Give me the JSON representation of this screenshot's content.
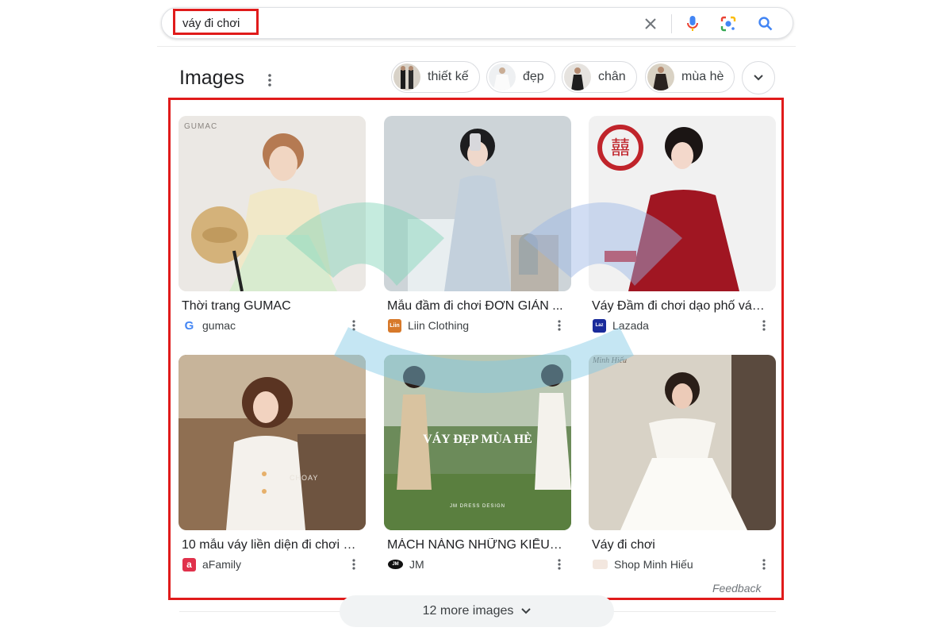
{
  "search": {
    "query": "váy đi chơi",
    "icons": [
      "close-icon",
      "microphone-icon",
      "lens-icon",
      "search-icon"
    ]
  },
  "images_section": {
    "title": "Images",
    "chips": [
      {
        "label": "thiết kế"
      },
      {
        "label": "đẹp"
      },
      {
        "label": "chân"
      },
      {
        "label": "mùa hè"
      }
    ],
    "results": [
      {
        "title": "Thời trang GUMAC",
        "source": "gumac",
        "image_text": "GUMAC"
      },
      {
        "title": "Mẫu đầm đi chơi ĐƠN GIẢN ...",
        "source": "Liin Clothing",
        "favicon_text": "Liin"
      },
      {
        "title": "Váy Đầm đi chơi dạo phố váy ...",
        "source": "Lazada",
        "favicon_text": "Laz"
      },
      {
        "title": "10 mẫu váy liền diện đi chơi c...",
        "source": "aFamily",
        "image_text": "CHOAY"
      },
      {
        "title": "MÁCH NÀNG NHỮNG KIỂU V...",
        "source": "JM",
        "favicon_text": "JM",
        "image_text": "VÁY ĐẸP MÙA HÈ",
        "image_subtext": "JM DRESS DESIGN"
      },
      {
        "title": "Váy đi chơi",
        "source": "Shop Minh Hiếu",
        "image_text": "Minh Hiếu"
      }
    ],
    "feedback": "Feedback",
    "more_images": "12 more images"
  },
  "colors": {
    "highlight_red": "#e01b1b",
    "google_blue": "#4285f4",
    "google_red": "#ea4335",
    "google_yellow": "#fbbc04",
    "google_green": "#34a853"
  }
}
